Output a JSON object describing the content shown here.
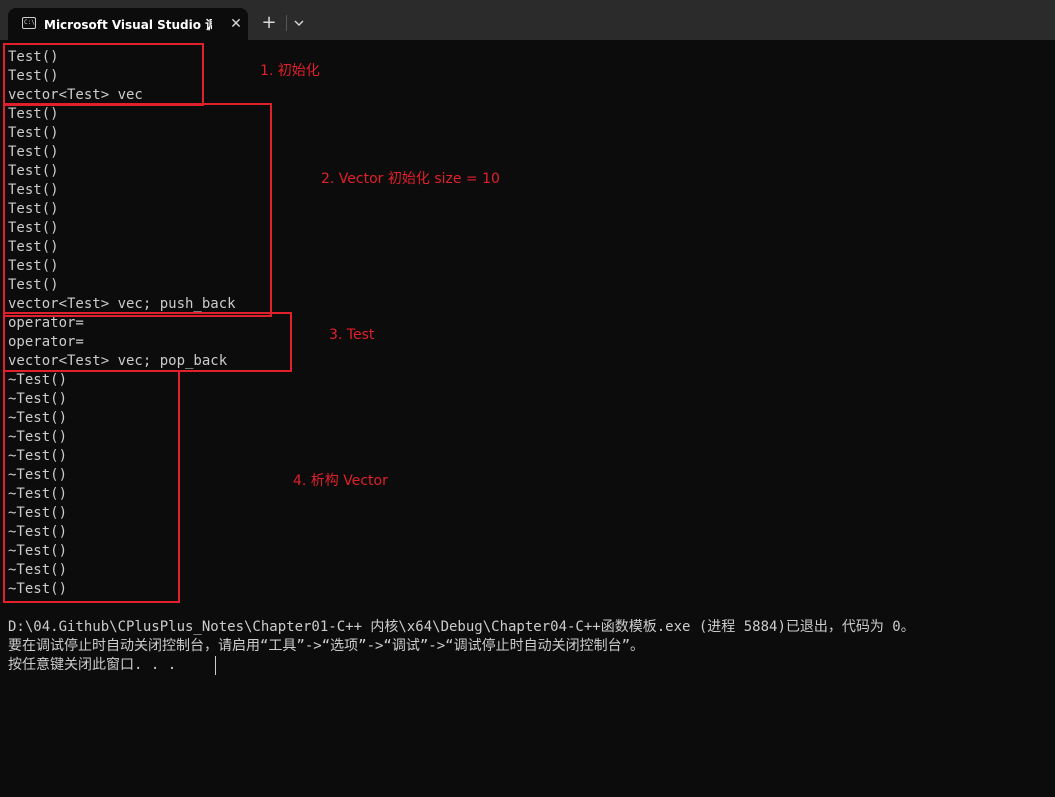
{
  "window": {
    "tab_title": "Microsoft Visual Studio 调试控制台",
    "close_glyph": "✕",
    "new_tab_glyph": "+"
  },
  "console": {
    "output_lines": [
      "Test()",
      "Test()",
      "vector<Test> vec",
      "Test()",
      "Test()",
      "Test()",
      "Test()",
      "Test()",
      "Test()",
      "Test()",
      "Test()",
      "Test()",
      "Test()",
      "vector<Test> vec; push_back",
      "operator=",
      "operator=",
      "vector<Test> vec; pop_back",
      "~Test()",
      "~Test()",
      "~Test()",
      "~Test()",
      "~Test()",
      "~Test()",
      "~Test()",
      "~Test()",
      "~Test()",
      "~Test()",
      "~Test()",
      "~Test()"
    ],
    "exit_lines": [
      "D:\\04.Github\\CPlusPlus_Notes\\Chapter01-C++ 内核\\x64\\Debug\\Chapter04-C++函数模板.exe (进程 5884)已退出，代码为 0。",
      "要在调试停止时自动关闭控制台，请启用“工具”->“选项”->“调试”->“调试停止时自动关闭控制台”。",
      "按任意键关闭此窗口. . ."
    ]
  },
  "annotations": [
    "1. 初始化",
    "2. Vector 初始化 size = 10",
    "3. Test",
    "4. 析构 Vector"
  ],
  "colors": {
    "background": "#0c0c0c",
    "titlebar": "#2b2b2b",
    "text": "#cccccc",
    "annotation_red": "#e0202a"
  }
}
